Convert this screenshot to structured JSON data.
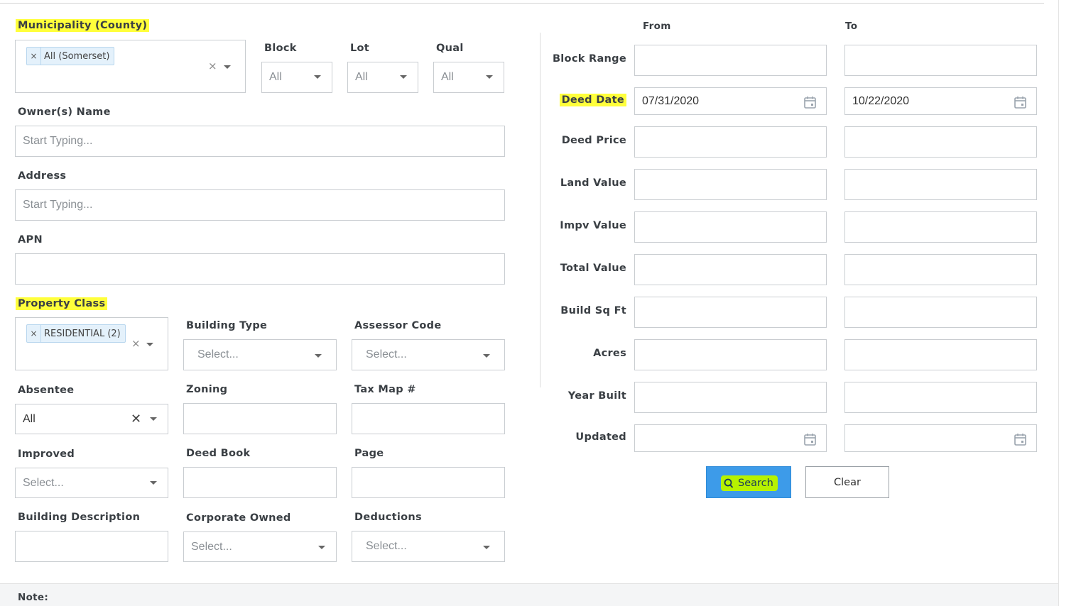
{
  "left": {
    "municipality": {
      "label": "Municipality (County)",
      "tag": "All (Somerset)",
      "tag_remove": "×",
      "clear": "×"
    },
    "block": {
      "label": "Block",
      "value": "All"
    },
    "lot": {
      "label": "Lot",
      "value": "All"
    },
    "qual": {
      "label": "Qual",
      "value": "All"
    },
    "owner": {
      "label": "Owner(s) Name",
      "placeholder": "Start Typing..."
    },
    "address": {
      "label": "Address",
      "placeholder": "Start Typing..."
    },
    "apn": {
      "label": "APN",
      "value": ""
    },
    "property_class": {
      "label": "Property Class",
      "tag": "RESIDENTIAL (2)",
      "tag_remove": "×",
      "clear": "×"
    },
    "building_type": {
      "label": "Building Type",
      "placeholder": "Select..."
    },
    "assessor_code": {
      "label": "Assessor Code",
      "placeholder": "Select..."
    },
    "absentee": {
      "label": "Absentee",
      "value": "All",
      "clear": "✕"
    },
    "zoning": {
      "label": "Zoning",
      "value": ""
    },
    "tax_map": {
      "label": "Tax Map #",
      "value": ""
    },
    "improved": {
      "label": "Improved",
      "placeholder": "Select..."
    },
    "deed_book": {
      "label": "Deed Book",
      "value": ""
    },
    "page": {
      "label": "Page",
      "value": ""
    },
    "building_description": {
      "label": "Building Description",
      "value": ""
    },
    "corporate_owned": {
      "label": "Corporate Owned",
      "placeholder": "Select..."
    },
    "deductions": {
      "label": "Deductions",
      "placeholder": "Select..."
    }
  },
  "right": {
    "from_header": "From",
    "to_header": "To",
    "rows": [
      {
        "label": "Block Range",
        "from": "",
        "to": ""
      },
      {
        "label": "Deed Date",
        "from": "07/31/2020",
        "to": "10/22/2020"
      },
      {
        "label": "Deed Price",
        "from": "",
        "to": ""
      },
      {
        "label": "Land Value",
        "from": "",
        "to": ""
      },
      {
        "label": "Impv Value",
        "from": "",
        "to": ""
      },
      {
        "label": "Total Value",
        "from": "",
        "to": ""
      },
      {
        "label": "Build Sq Ft",
        "from": "",
        "to": ""
      },
      {
        "label": "Acres",
        "from": "",
        "to": ""
      },
      {
        "label": "Year Built",
        "from": "",
        "to": ""
      },
      {
        "label": "Updated",
        "from": "",
        "to": ""
      }
    ]
  },
  "actions": {
    "search_label": "Search",
    "clear_label": "Clear"
  },
  "footer": {
    "note_label": "Note:"
  },
  "colors": {
    "highlight": "#ffff3b",
    "search_button": "#3d9be9",
    "search_highlight": "#b7f200"
  },
  "icons": {
    "calendar": "calendar-icon",
    "search": "search-icon",
    "dropdown": "chevron-down-icon",
    "clear": "close-icon"
  }
}
